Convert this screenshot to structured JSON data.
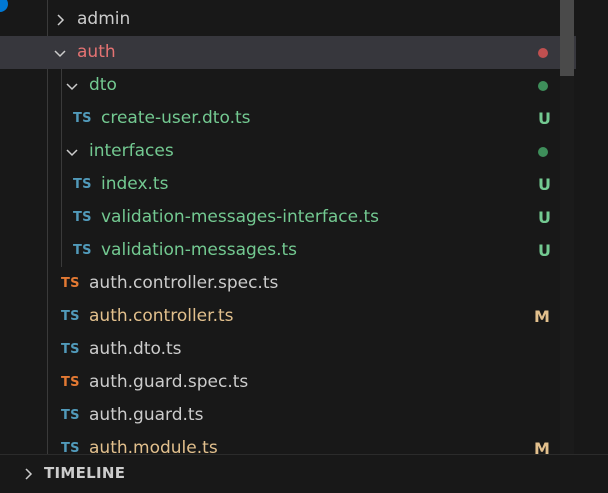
{
  "explorer": {
    "rows": [
      {
        "label": "admin",
        "type": "folder",
        "expanded": false,
        "status": "",
        "status_color": "#cccccc"
      },
      {
        "label": "auth",
        "type": "folder",
        "expanded": true,
        "status": "dot",
        "status_color": "#c05050"
      },
      {
        "label": "dto",
        "type": "folder",
        "expanded": true,
        "status": "dot",
        "status_color": "#3e8e5a"
      },
      {
        "label": "create-user.dto.ts",
        "type": "ts-file",
        "icon": "TS",
        "status": "U"
      },
      {
        "label": "interfaces",
        "type": "folder",
        "expanded": true,
        "status": "dot",
        "status_color": "#3e8e5a"
      },
      {
        "label": "index.ts",
        "type": "ts-file",
        "icon": "TS",
        "status": "U"
      },
      {
        "label": "validation-messages-interface.ts",
        "type": "ts-file",
        "icon": "TS",
        "status": "U"
      },
      {
        "label": "validation-messages.ts",
        "type": "ts-file",
        "icon": "TS",
        "status": "U"
      },
      {
        "label": "auth.controller.spec.ts",
        "type": "ts-file",
        "icon": "TS",
        "status": ""
      },
      {
        "label": "auth.controller.ts",
        "type": "ts-file",
        "icon": "TS",
        "status": "M"
      },
      {
        "label": "auth.dto.ts",
        "type": "ts-file",
        "icon": "TS",
        "status": ""
      },
      {
        "label": "auth.guard.spec.ts",
        "type": "ts-file",
        "icon": "TS",
        "status": ""
      },
      {
        "label": "auth.guard.ts",
        "type": "ts-file",
        "icon": "TS",
        "status": ""
      },
      {
        "label": "auth.module.ts",
        "type": "ts-file",
        "icon": "TS",
        "status": "M"
      }
    ]
  },
  "colors": {
    "untracked": "#73c991",
    "modified": "#e2c08d",
    "error_folder": "#e57373",
    "ts_blue": "#519aba",
    "ts_orange": "#e37933"
  },
  "timeline": {
    "label": "TIMELINE"
  }
}
